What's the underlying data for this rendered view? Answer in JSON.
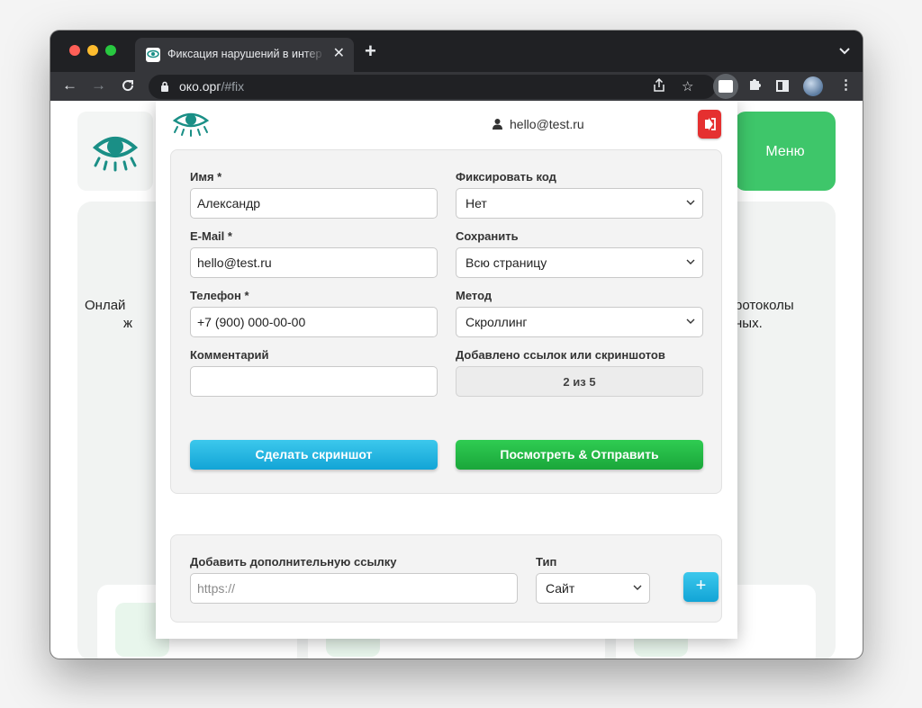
{
  "browser": {
    "tab_title": "Фиксация нарушений в интер",
    "url_host": "око.орг",
    "url_path": "/#fix"
  },
  "site": {
    "menu_label": "Меню",
    "hero_left_line1": "Онлай",
    "hero_left_line2": "ж",
    "hero_right_line1": "ротоколы",
    "hero_right_line2": "ных."
  },
  "popup": {
    "user_email": "hello@test.ru",
    "form": {
      "name_label": "Имя *",
      "name_value": "Александр",
      "email_label": "E-Mail *",
      "email_value": "hello@test.ru",
      "phone_label": "Телефон *",
      "phone_value": "+7 (900) 000-00-00",
      "comment_label": "Комментарий",
      "comment_value": "",
      "fix_code_label": "Фиксировать код",
      "fix_code_value": "Нет",
      "save_label": "Сохранить",
      "save_value": "Всю страницу",
      "method_label": "Метод",
      "method_value": "Скроллинг",
      "added_label": "Добавлено ссылок или скриншотов",
      "added_value": "2 из 5",
      "screenshot_button": "Сделать скриншот",
      "send_button": "Посмотреть & Отправить"
    },
    "extra": {
      "link_label": "Добавить дополнительную ссылку",
      "link_placeholder": "https://",
      "type_label": "Тип",
      "type_value": "Сайт",
      "add_button": "+"
    }
  },
  "colors": {
    "accent_green": "#1fb142",
    "accent_blue": "#1aaee0",
    "logout_red": "#e53030",
    "logo_teal": "#1a8f86"
  }
}
